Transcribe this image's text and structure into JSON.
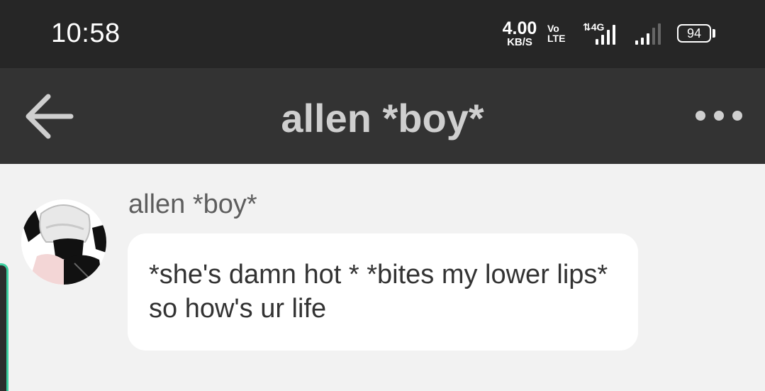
{
  "status_bar": {
    "time": "10:58",
    "net_speed_value": "4.00",
    "net_speed_unit": "KB/S",
    "volte_top": "Vo",
    "volte_bottom": "LTE",
    "network_type": "4G",
    "battery": "94"
  },
  "app_bar": {
    "title": "allen *boy*",
    "back_icon": "arrow-left-icon",
    "more_icon": "more-horizontal-icon"
  },
  "chat": {
    "messages": [
      {
        "sender": "allen *boy*",
        "avatar_icon": "avatar-image",
        "text": "*she's damn hot * *bites my lower lips* so how's ur life"
      }
    ]
  },
  "colors": {
    "status_bar_bg": "#262626",
    "app_bar_bg": "#333333",
    "chat_bg": "#f2f2f2",
    "bubble_bg": "#ffffff",
    "title_text": "#cfcfcf",
    "accent": "#3ccf9f"
  }
}
